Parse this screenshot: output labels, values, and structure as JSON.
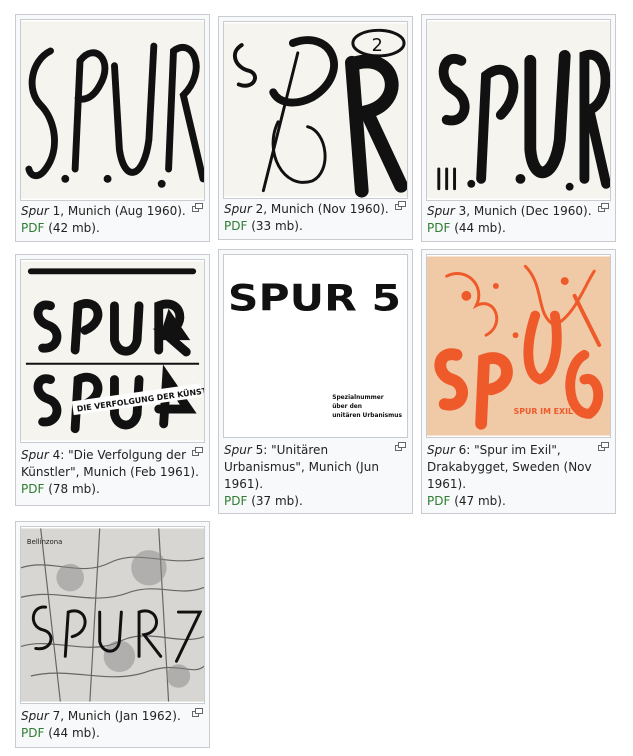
{
  "gallery": [
    {
      "issue": "Spur",
      "rest": " 1, Munich (Aug 1960).",
      "pdf": "PDF",
      "size": " (42 mb).",
      "cover": "spur-1-cover"
    },
    {
      "issue": "Spur",
      "rest": " 2, Munich (Nov 1960).",
      "pdf": "PDF",
      "size": " (33 mb).",
      "cover": "spur-2-cover"
    },
    {
      "issue": "Spur",
      "rest": " 3, Munich (Dec 1960).",
      "pdf": "PDF",
      "size": " (44 mb).",
      "cover": "spur-3-cover"
    },
    {
      "issue": "Spur",
      "rest": " 4: \"Die Verfolgung der Künstler\", Munich (Feb 1961).",
      "pdf": "PDF",
      "size": " (78 mb).",
      "cover": "spur-4-cover"
    },
    {
      "issue": "Spur",
      "rest": " 5: \"Unitären Urbanismus\", Munich (Jun 1961).",
      "pdf": "PDF",
      "size": " (37 mb).",
      "cover": "spur-5-cover"
    },
    {
      "issue": "Spur",
      "rest": " 6: \"Spur im Exil\", Drakabygget, Sweden (Nov 1961).",
      "pdf": "PDF",
      "size": " (47 mb).",
      "cover": "spur-6-cover"
    },
    {
      "issue": "Spur",
      "rest": " 7, Munich (Jan 1962).",
      "pdf": "PDF",
      "size": " (44 mb).",
      "cover": "spur-7-cover"
    }
  ],
  "cover_texts": {
    "spur2_number": "2",
    "spur4_banner": "DIE VERFOLGUNG DER KÜNSTLER",
    "spur5_title": "SPUR 5",
    "spur5_sub1": "Spezialnummer",
    "spur5_sub2": "über den",
    "spur5_sub3": "unitären Urbanismus",
    "spur6_exil": "SPUR IM EXIL",
    "spur7_place": "Bellinzona"
  },
  "colors": {
    "pdf_link": "#2e7d32",
    "border": "#c8ccd1",
    "spur6_bg": "#f0c9a6",
    "spur6_ink": "#ef5a2a"
  }
}
